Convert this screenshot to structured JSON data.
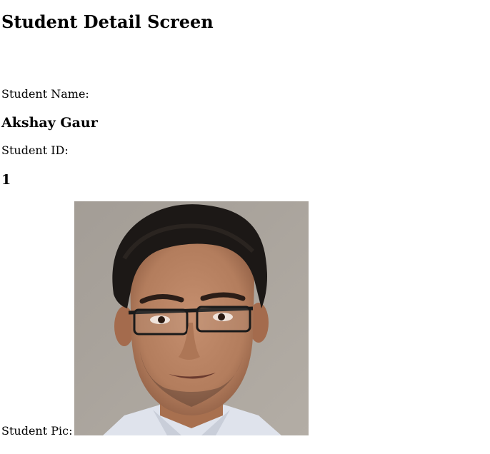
{
  "page": {
    "title": "Student Detail Screen"
  },
  "student": {
    "name_label": "Student Name:",
    "name_value": "Akshay Gaur",
    "id_label": "Student ID:",
    "id_value": "1",
    "pic_label": "Student Pic:",
    "photo_description": "portrait-photo"
  }
}
